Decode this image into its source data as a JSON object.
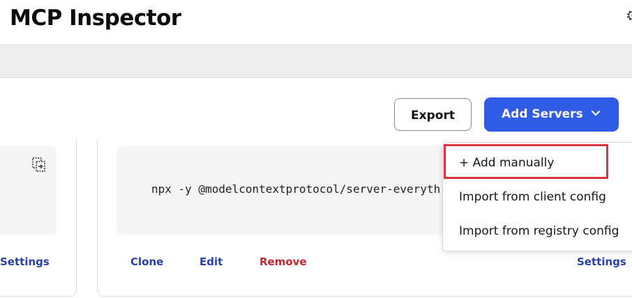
{
  "header": {
    "title": "MCP Inspector",
    "settings_icon": "gear-icon"
  },
  "toolbar": {
    "export_label": "Export",
    "add_servers_label": "Add Servers",
    "add_servers_chevron": "chevron-down-icon"
  },
  "servers": [
    {
      "command": "",
      "actions": {
        "settings": "Settings"
      }
    },
    {
      "command": "npx -y @modelcontextprotocol/server-everyth",
      "actions": {
        "clone": "Clone",
        "edit": "Edit",
        "remove": "Remove",
        "settings": "Settings"
      }
    }
  ],
  "add_menu": {
    "items": [
      {
        "label": "+ Add manually"
      },
      {
        "label": "Import from client config"
      },
      {
        "label": "Import from registry config"
      }
    ],
    "highlight_color": "#d9363e"
  },
  "colors": {
    "accent": "#2f5be5",
    "link": "#2840a6",
    "danger": "#c3262e"
  }
}
